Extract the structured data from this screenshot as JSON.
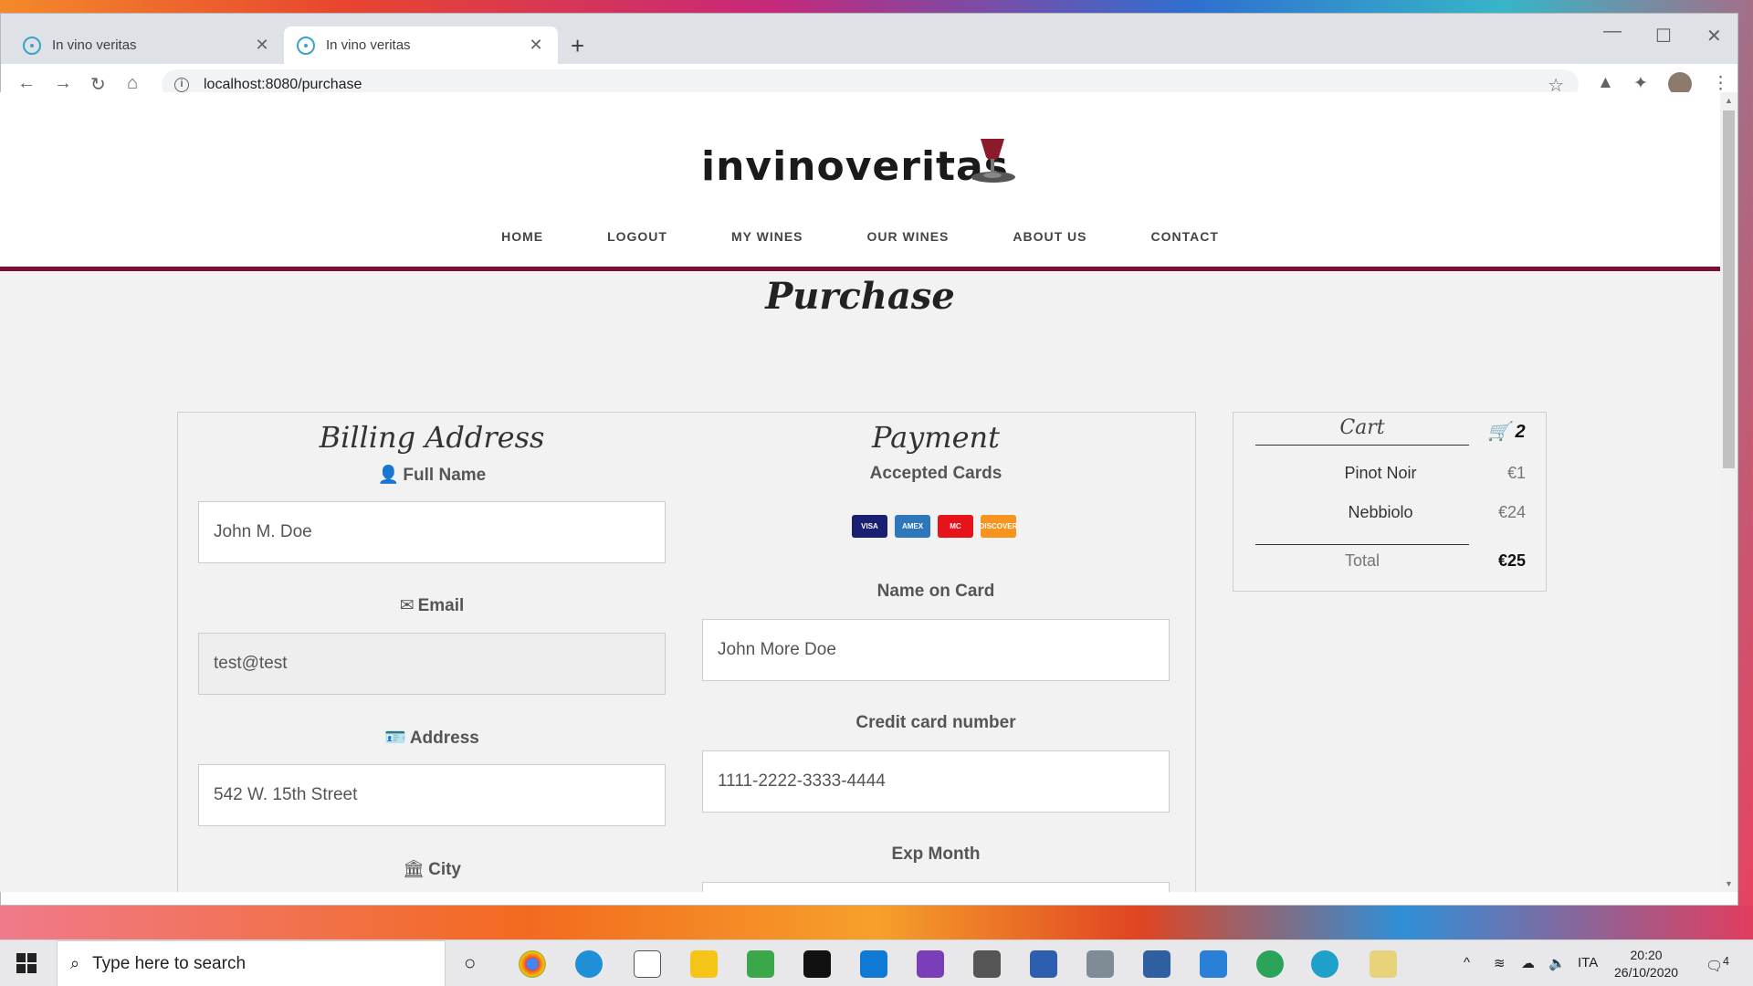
{
  "browser": {
    "tabs": [
      {
        "title": "In vino veritas",
        "close": "✕"
      },
      {
        "title": "In vino veritas",
        "close": "✕"
      }
    ],
    "new_tab": "+",
    "window_controls": {
      "minimize": "—",
      "maximize": "☐",
      "close": "✕"
    },
    "nav": {
      "back": "←",
      "forward": "→",
      "reload": "↻",
      "home": "⌂"
    },
    "url": "localhost:8080/purchase",
    "info_icon": "i",
    "star": "☆"
  },
  "site": {
    "logo": "invinoveritas",
    "nav": [
      "HOME",
      "LOGOUT",
      "MY WINES",
      "OUR WINES",
      "ABOUT US",
      "CONTACT"
    ],
    "page_title": "Purchase"
  },
  "billing": {
    "title": "Billing Address",
    "fields": [
      {
        "label": "Full Name",
        "icon": "user-icon",
        "glyph": "👤",
        "value": "John M. Doe"
      },
      {
        "label": "Email",
        "icon": "envelope-icon",
        "glyph": "✉",
        "value": "test@test"
      },
      {
        "label": "Address",
        "icon": "address-card-icon",
        "glyph": "🪪",
        "value": "542 W. 15th Street"
      },
      {
        "label": "City",
        "icon": "institution-icon",
        "glyph": "🏛",
        "value": ""
      }
    ]
  },
  "payment": {
    "title": "Payment",
    "accepted_cards_label": "Accepted Cards",
    "cards": [
      "VISA",
      "AMEX",
      "MC",
      "DISCOVER"
    ],
    "fields": [
      {
        "label": "Name on Card",
        "value": "John More Doe"
      },
      {
        "label": "Credit card number",
        "value": "1111-2222-3333-4444"
      },
      {
        "label": "Exp Month",
        "value": ""
      }
    ]
  },
  "cart": {
    "title": "Cart",
    "count": "2",
    "items": [
      {
        "name": "Pinot Noir",
        "price": "€1"
      },
      {
        "name": "Nebbiolo",
        "price": "€24"
      }
    ],
    "total_label": "Total",
    "total": "€25"
  },
  "taskbar": {
    "search_placeholder": "Type here to search",
    "language": "ITA",
    "time": "20:20",
    "date": "26/10/2020",
    "notifications": "4"
  },
  "colors": {
    "accent": "#7a0f2f"
  }
}
